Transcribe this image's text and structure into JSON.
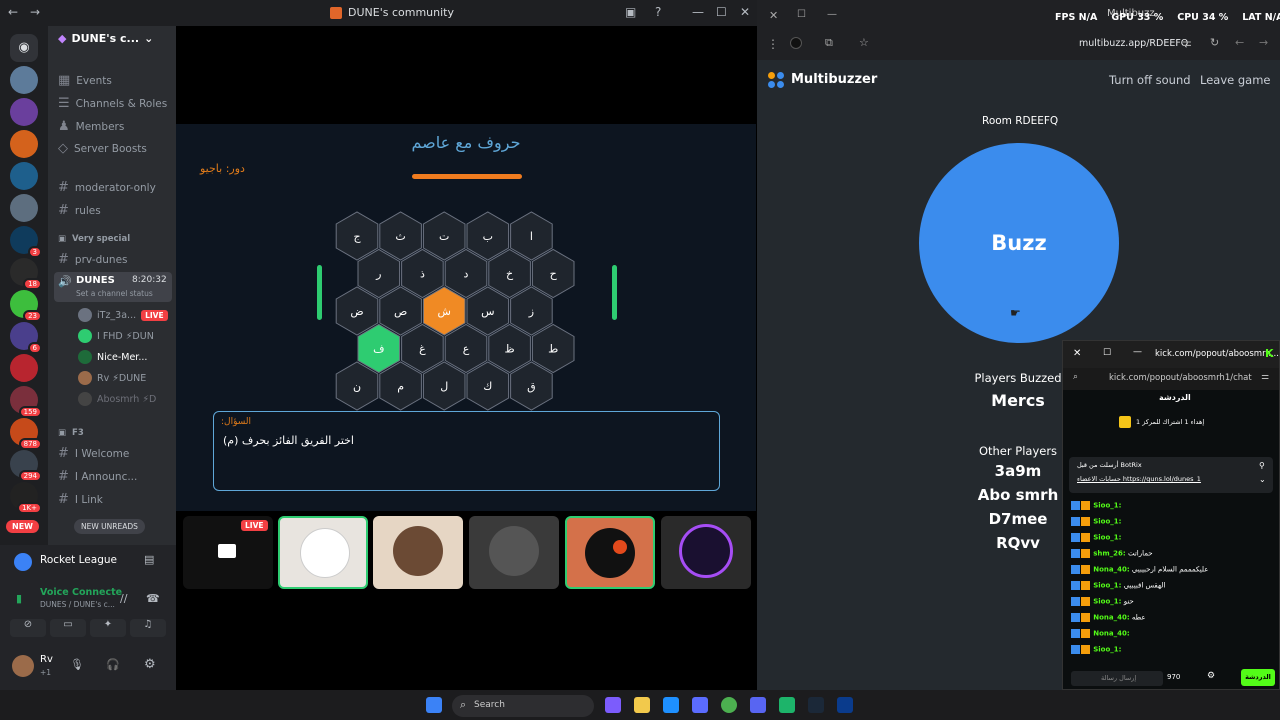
{
  "discord": {
    "window_title": "DUNE's community",
    "server_name": "DUNE's c...",
    "menu": [
      "Events",
      "Channels & Roles",
      "Members",
      "Server Boosts"
    ],
    "channels": [
      "moderator-only",
      "rules"
    ],
    "category_special": "Very special",
    "prv": "prv-dunes",
    "voice_channel": "DUNES",
    "voice_time": "8:20:32",
    "channel_status": "Set a channel status",
    "voice_users": [
      "iTz_3a...",
      "I FHD ⚡DUN",
      "Nice-Mer...",
      "Rv ⚡DUNE",
      "Abosmrh ⚡D"
    ],
    "live_label": "LIVE",
    "category_f3": "F3",
    "f3_channels": [
      "I Welcome",
      "I Announc...",
      "I Link"
    ],
    "new_unreads": "NEW UNREADS",
    "new_badge": "NEW",
    "server_badges": [
      "3",
      "18",
      "23",
      "6",
      "159",
      "878",
      "294",
      "1K+"
    ],
    "activity": "Rocket League",
    "voice_connected": "Voice Connecte",
    "voice_sub": "DUNES / DUNE's c...",
    "user": "Rv",
    "user_sub": "+1"
  },
  "game": {
    "title": "حروف مع عاصم",
    "turn": "دور: باجيو",
    "rows": [
      [
        "ا",
        "ب",
        "ت",
        "ث",
        "ج"
      ],
      [
        "ح",
        "خ",
        "د",
        "ذ",
        "ر"
      ],
      [
        "ز",
        "س",
        "ش",
        "ص",
        "ض"
      ],
      [
        "ط",
        "ظ",
        "ع",
        "غ",
        "ف"
      ],
      [
        "ق",
        "ك",
        "ل",
        "م",
        "ن"
      ]
    ],
    "question_label": "السؤال:",
    "question": "اختر الفريق الفائز بحرف (م)",
    "stream_live": "LIVE"
  },
  "overlay": {
    "fps_label": "FPS",
    "fps": "N/A",
    "gpu_label": "GPU",
    "gpu": "33 %",
    "cpu_label": "CPU",
    "cpu": "34 %",
    "lat_label": "LAT",
    "lat": "N/A",
    "tab": "Multibuzz"
  },
  "browser": {
    "url": "multibuzz.app/RDEEFQ"
  },
  "multibuzz": {
    "brand": "Multibuzzer",
    "turn_off_sound": "Turn off sound",
    "leave_game": "Leave game",
    "room": "Room RDEEFQ",
    "buzz": "Buzz",
    "players_buzzed_label": "Players Buzzed",
    "buzzed": [
      "Mercs"
    ],
    "other_players_label": "Other Players",
    "others": [
      "3a9m",
      "Abo smrh",
      "D7mee",
      "RQvv"
    ]
  },
  "kick": {
    "title": "kick.com/popout/aboosmrh...",
    "url": "kick.com/popout/aboosmrh1/chat",
    "header": "الدردشة",
    "pinned": "إهداء 1 اشتراك للمركز 1",
    "bot_line1": "أرسلت من قبل BotRix",
    "bot_line2": "حسابات الاعضاء https://guns.lol/dunes_1",
    "messages": [
      {
        "user": "Sioo_1:",
        "text": ""
      },
      {
        "user": "Sioo_1:",
        "text": ""
      },
      {
        "user": "Sioo_1:",
        "text": ""
      },
      {
        "user": "shm_26:",
        "text": "حماراتت"
      },
      {
        "user": "Nona_40:",
        "text": "عليكمممم السلام ارحبيبيي"
      },
      {
        "user": "Sioo_1:",
        "text": "الهقس اقبيبيي"
      },
      {
        "user": "Sioo_1:",
        "text": "حنو"
      },
      {
        "user": "Nona_40:",
        "text": "عطه"
      },
      {
        "user": "Nona_40:",
        "text": ""
      },
      {
        "user": "Sioo_1:",
        "text": ""
      }
    ],
    "input_placeholder": "إرسال رسالة",
    "points": "970",
    "send": "الدردشة"
  },
  "taskbar": {
    "search": "Search"
  }
}
